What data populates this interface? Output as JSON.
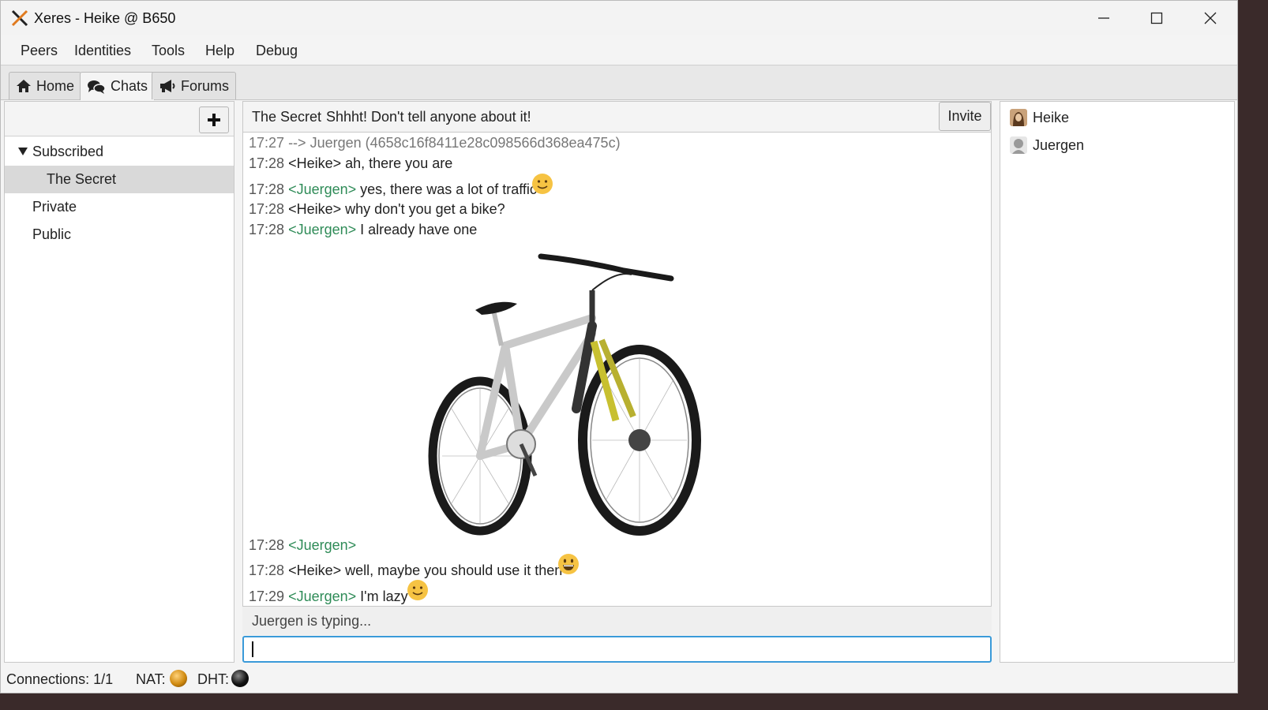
{
  "window": {
    "title": "Xeres - Heike @ B650"
  },
  "menu": [
    "Peers",
    "Identities",
    "Tools",
    "Help",
    "Debug"
  ],
  "tabs": [
    {
      "label": "Home",
      "icon": "home-icon"
    },
    {
      "label": "Chats",
      "icon": "chats-icon",
      "active": true
    },
    {
      "label": "Forums",
      "icon": "megaphone-icon"
    }
  ],
  "rooms": {
    "group_label": "Subscribed",
    "subscribed": [
      {
        "label": "The Secret",
        "selected": true
      }
    ],
    "other": [
      "Private",
      "Public"
    ]
  },
  "chat": {
    "room_name": "The Secret",
    "topic": "Shhht! Don't tell anyone about it!",
    "invite_label": "Invite",
    "messages": [
      {
        "time": "17:27",
        "nick": "",
        "text": "--> Juergen (4658c16f8411e28c098566d368ea475c)",
        "type": "system"
      },
      {
        "time": "17:28",
        "nick": "<Heike>",
        "text": "ah, there you are",
        "type": "self"
      },
      {
        "time": "17:28",
        "nick": "<Juergen>",
        "text": "yes, there was a lot of traffic",
        "type": "peer",
        "emoji": "slight-smile-emoji"
      },
      {
        "time": "17:28",
        "nick": "<Heike>",
        "text": "why don't you get a bike?",
        "type": "self"
      },
      {
        "time": "17:28",
        "nick": "<Juergen>",
        "text": "I already have one",
        "type": "peer"
      },
      {
        "time": "17:28",
        "nick": "<Juergen>",
        "text": "",
        "type": "peer",
        "image": "bicycle-image"
      },
      {
        "time": "17:28",
        "nick": "<Heike>",
        "text": "well, maybe you should use it then",
        "type": "self",
        "emoji": "grin-emoji"
      },
      {
        "time": "17:29",
        "nick": "<Juergen>",
        "text": "I'm lazy",
        "type": "peer",
        "emoji": "slight-smile-emoji"
      }
    ],
    "typing_status": "Juergen is typing...",
    "input_value": ""
  },
  "users": [
    {
      "name": "Heike",
      "avatar": "heike-avatar"
    },
    {
      "name": "Juergen",
      "avatar": "juergen-avatar"
    }
  ],
  "status": {
    "connections": "Connections: 1/1",
    "nat_label": "NAT:",
    "nat_color": "#d08a10",
    "dht_label": "DHT:",
    "dht_color": "#111111"
  },
  "colors": {
    "peer_nick": "#2e8b57",
    "input_focus": "#3a9ad9",
    "selected_row": "#d9d9d9"
  }
}
